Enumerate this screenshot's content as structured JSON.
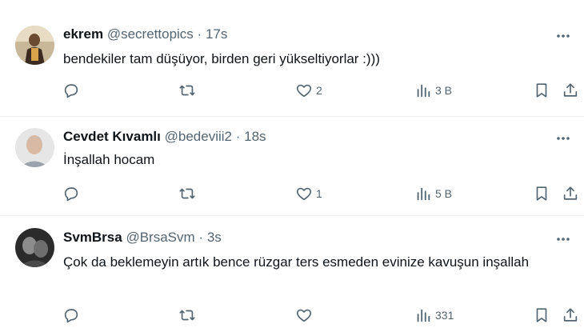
{
  "tweets": [
    {
      "name": "ekrem",
      "handle": "@secrettopics",
      "separator": "·",
      "time": "17s",
      "text": "bendekiler tam düşüyor, birden geri yükseltiyorlar :)))",
      "replies": "",
      "retweets": "",
      "likes": "2",
      "views": "3 B",
      "avatar_icon": "profile-photo"
    },
    {
      "name": "Cevdet Kıvamlı",
      "handle": "@bedeviii2",
      "separator": "·",
      "time": "18s",
      "text": "İnşallah hocam",
      "replies": "",
      "retweets": "",
      "likes": "1",
      "views": "5 B",
      "avatar_icon": "profile-photo"
    },
    {
      "name": "SvmBrsa",
      "handle": "@BrsaSvm",
      "separator": "·",
      "time": "3s",
      "text": "Çok da beklemeyin artık bence rüzgar ters esmeden evinize kavuşun inşallah",
      "replies": "",
      "retweets": "",
      "likes": "",
      "views": "331",
      "avatar_icon": "profile-photo"
    }
  ],
  "icons": {
    "reply": "reply-icon",
    "retweet": "retweet-icon",
    "like": "heart-icon",
    "views": "analytics-icon",
    "bookmark": "bookmark-icon",
    "share": "share-icon",
    "more": "more-icon"
  },
  "colors": {
    "text": "#0f1419",
    "secondary": "#536471",
    "divider": "#eff3f4"
  }
}
